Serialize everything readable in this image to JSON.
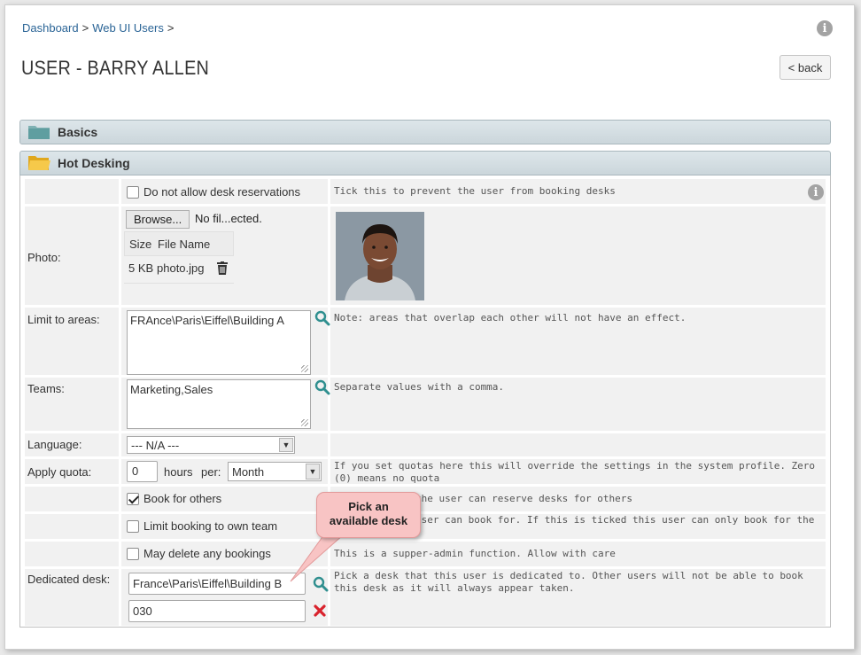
{
  "breadcrumb": {
    "items": [
      "Dashboard",
      "Web UI Users"
    ],
    "separator": ">"
  },
  "page": {
    "title": "USER - BARRY ALLEN",
    "back_label": "< back",
    "info_icon": "info-icon"
  },
  "sections": {
    "basics": "Basics",
    "hot_desking": "Hot Desking"
  },
  "form": {
    "no_desk_reservations": {
      "label": "Do not allow desk reservations",
      "checked": false,
      "help": "Tick this to prevent the user from booking desks"
    },
    "photo": {
      "label": "Photo:",
      "browse_label": "Browse...",
      "file_status": "No fil...ected.",
      "col_size": "Size",
      "col_name": "File Name",
      "file_size": "5 KB",
      "file_name": "photo.jpg"
    },
    "limit_areas": {
      "label": "Limit to areas:",
      "value": "FRAnce\\Paris\\Eiffel\\Building A",
      "help": "Note: areas that overlap each other will not have an effect."
    },
    "teams": {
      "label": "Teams:",
      "value": "Marketing,Sales",
      "help": "Separate values with a comma."
    },
    "language": {
      "label": "Language:",
      "value": "--- N/A ---"
    },
    "quota": {
      "label": "Apply quota:",
      "value": "0",
      "hours_label": "hours",
      "per_label": "per:",
      "period": "Month",
      "help": "If you set quotas here this will override the settings in the system profile. Zero (0) means no quota"
    },
    "book_for_others": {
      "label": "Book for others",
      "checked": true,
      "help": "the user can reserve desks for others"
    },
    "limit_own_team": {
      "label": "Limit booking to own team",
      "checked": false,
      "help": "user can book for. If this is ticked this user can only book for the"
    },
    "may_delete": {
      "label": "May delete any bookings",
      "checked": false,
      "help": "This is a supper-admin function.  Allow with care"
    },
    "dedicated_desk": {
      "label": "Dedicated desk:",
      "area_value": "France\\Paris\\Eiffel\\Building B",
      "desk_value": "030",
      "help": "Pick a desk that this user is dedicated to. Other users will not be able to book this desk as it will always appear taken."
    }
  },
  "callout": {
    "line1": "Pick an",
    "line2": "available desk"
  },
  "colors": {
    "link": "#2a6496",
    "search_icon": "#2f8f8f",
    "delete_icon": "#d9232d",
    "folder": "#f2c531",
    "callout_bg": "#f8c4c4"
  }
}
